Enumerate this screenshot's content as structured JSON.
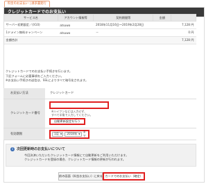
{
  "tab_label": "料金のお支払い | 請求書発行",
  "panel_title": "クレジットカードでのお支払い",
  "service_table": {
    "headers": [
      "サービス名",
      "アカウント情報等",
      "契約期間等",
      "金額",
      ""
    ],
    "rows": [
      {
        "service": "サーバー初期設定／(X10)",
        "account": "atsuwo",
        "period": "2018年11月16日～2019年2月28日",
        "amount": "",
        "total": "7,128 円"
      },
      {
        "service": "1ドメイン無料キャンペーン",
        "account": "atsuwo",
        "period": "－",
        "amount": "",
        "total": "0 円"
      }
    ],
    "total_label": "金額合計",
    "total_value": "7,128 円"
  },
  "notes": [
    "クレジットカードでのお支払い手続きを行います。",
    "下記フォームに必要事項をご入力ください。",
    "※お支払い手続きの送信は、SSLによりすべて暗号化されます。"
  ],
  "form": {
    "method_label": "お支払い方法",
    "method_value": "クレジットカード",
    "card_label": "クレジットカード番号",
    "card_note_1": "※ハイフンなどは入力せず、",
    "card_note_2": "すべて半角で入力してください。",
    "auto_renew_button": "自動更新設定を行う",
    "expiry_label": "有効期限",
    "month_value": "1月",
    "year_value": "2018年",
    "expiry_suffix": "まで"
  },
  "info": {
    "icon_letter": "i",
    "title": "次回更新時のお支払いについて",
    "line1": "今回決済いただいたクレジットカード情報にて自動更新をご利用いただけます。",
    "line2": "クレジットカードを登録の場合、クレジットカード情報の更新が行われます。"
  },
  "buttons": {
    "back": "前の画面（料金お支払い）に戻る",
    "next": "カードでのお支払い（確定）"
  },
  "colors": {
    "header_bg": "#3a3a3a",
    "highlight_red": "#e02020",
    "tab_orange": "#e06a2c"
  }
}
